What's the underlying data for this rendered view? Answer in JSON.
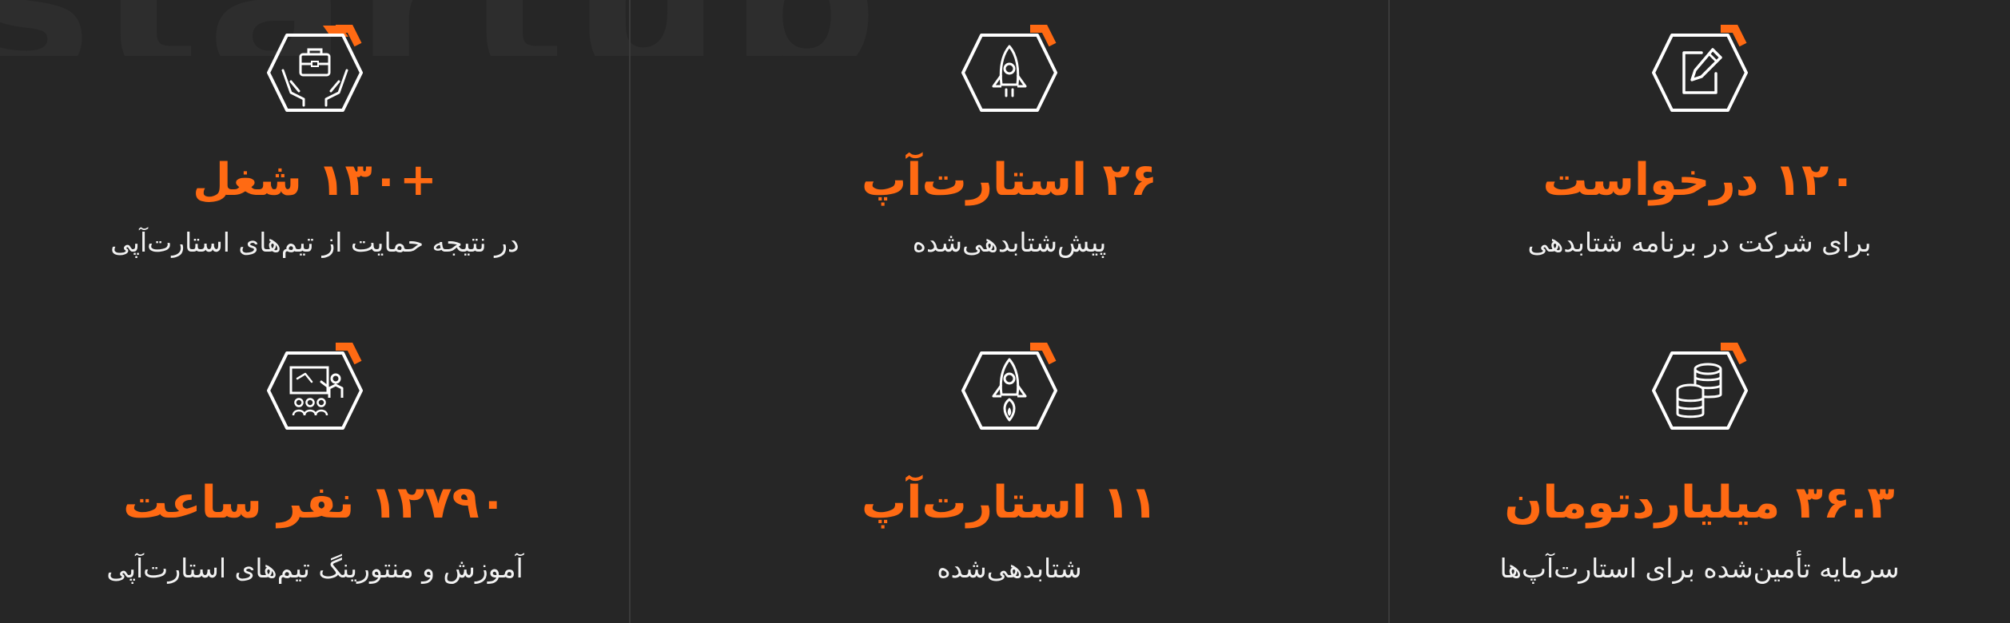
{
  "colors": {
    "background": "#262626",
    "accent": "#ff6a13",
    "text": "#f2f2f2",
    "icon_stroke": "#ffffff",
    "divider": "#3a3a3a"
  },
  "stats": [
    {
      "value": "+۱۳۰ شغل",
      "caption": "در نتیجه حمایت از تیم‌های استارت‌آپی",
      "icon": "hands-briefcase-icon"
    },
    {
      "value": "۲۶ استارت‌آپ",
      "caption": "پیش‌شتابدهی‌شده",
      "icon": "rocket-icon"
    },
    {
      "value": "۱۲۰ درخواست",
      "caption": "برای شرکت در برنامه شتابدهی",
      "icon": "edit-document-icon"
    },
    {
      "value": "۱۲۷۹۰ نفر ساعت",
      "caption": "آموزش و منتورینگ تیم‌های استارت‌آپی",
      "icon": "presentation-audience-icon"
    },
    {
      "value": "۱۱ استارت‌آپ",
      "caption": "شتابدهی‌شده",
      "icon": "rocket-launch-icon"
    },
    {
      "value": "۳۶.۳ میلیاردتومان",
      "caption": "سرمایه تأمین‌شده برای استارت‌آپ‌ها",
      "icon": "coin-stack-icon"
    }
  ]
}
